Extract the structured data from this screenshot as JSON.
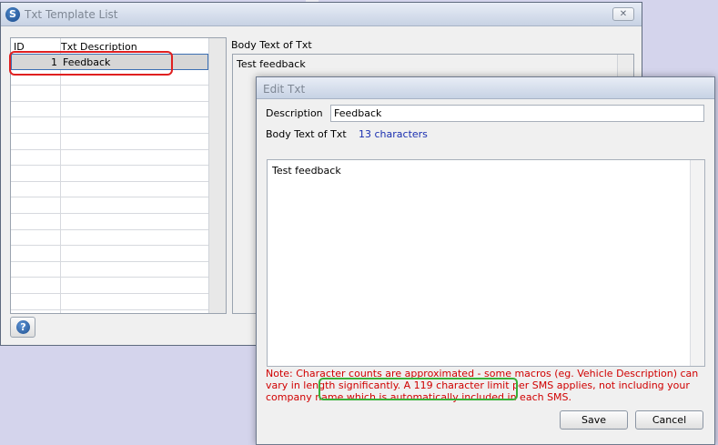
{
  "list_window": {
    "title": "Txt Template List",
    "app_icon_letter": "S",
    "close_glyph": "✕",
    "grid": {
      "columns": [
        "ID",
        "Txt Description"
      ],
      "rows": [
        {
          "id": "1",
          "description": "Feedback"
        }
      ]
    },
    "body_text_label": "Body Text of Txt",
    "body_text": "Test feedback",
    "help_glyph": "?"
  },
  "edit_window": {
    "title": "Edit Txt",
    "description_label": "Description",
    "description_value": "Feedback",
    "body_label": "Body Text of Txt",
    "char_count": "13 characters",
    "body_value": "Test feedback",
    "note": "Note: Character counts are approximated - some macros (eg. Vehicle Description) can vary in length significantly. A 119 character limit per SMS applies, not including your company name which is automatically included in each SMS.",
    "save_label": "Save",
    "cancel_label": "Cancel"
  },
  "colors": {
    "highlight_red": "#e02020",
    "highlight_green": "#38b038",
    "note_text": "#d00000",
    "char_count_text": "#1a2fb0"
  }
}
